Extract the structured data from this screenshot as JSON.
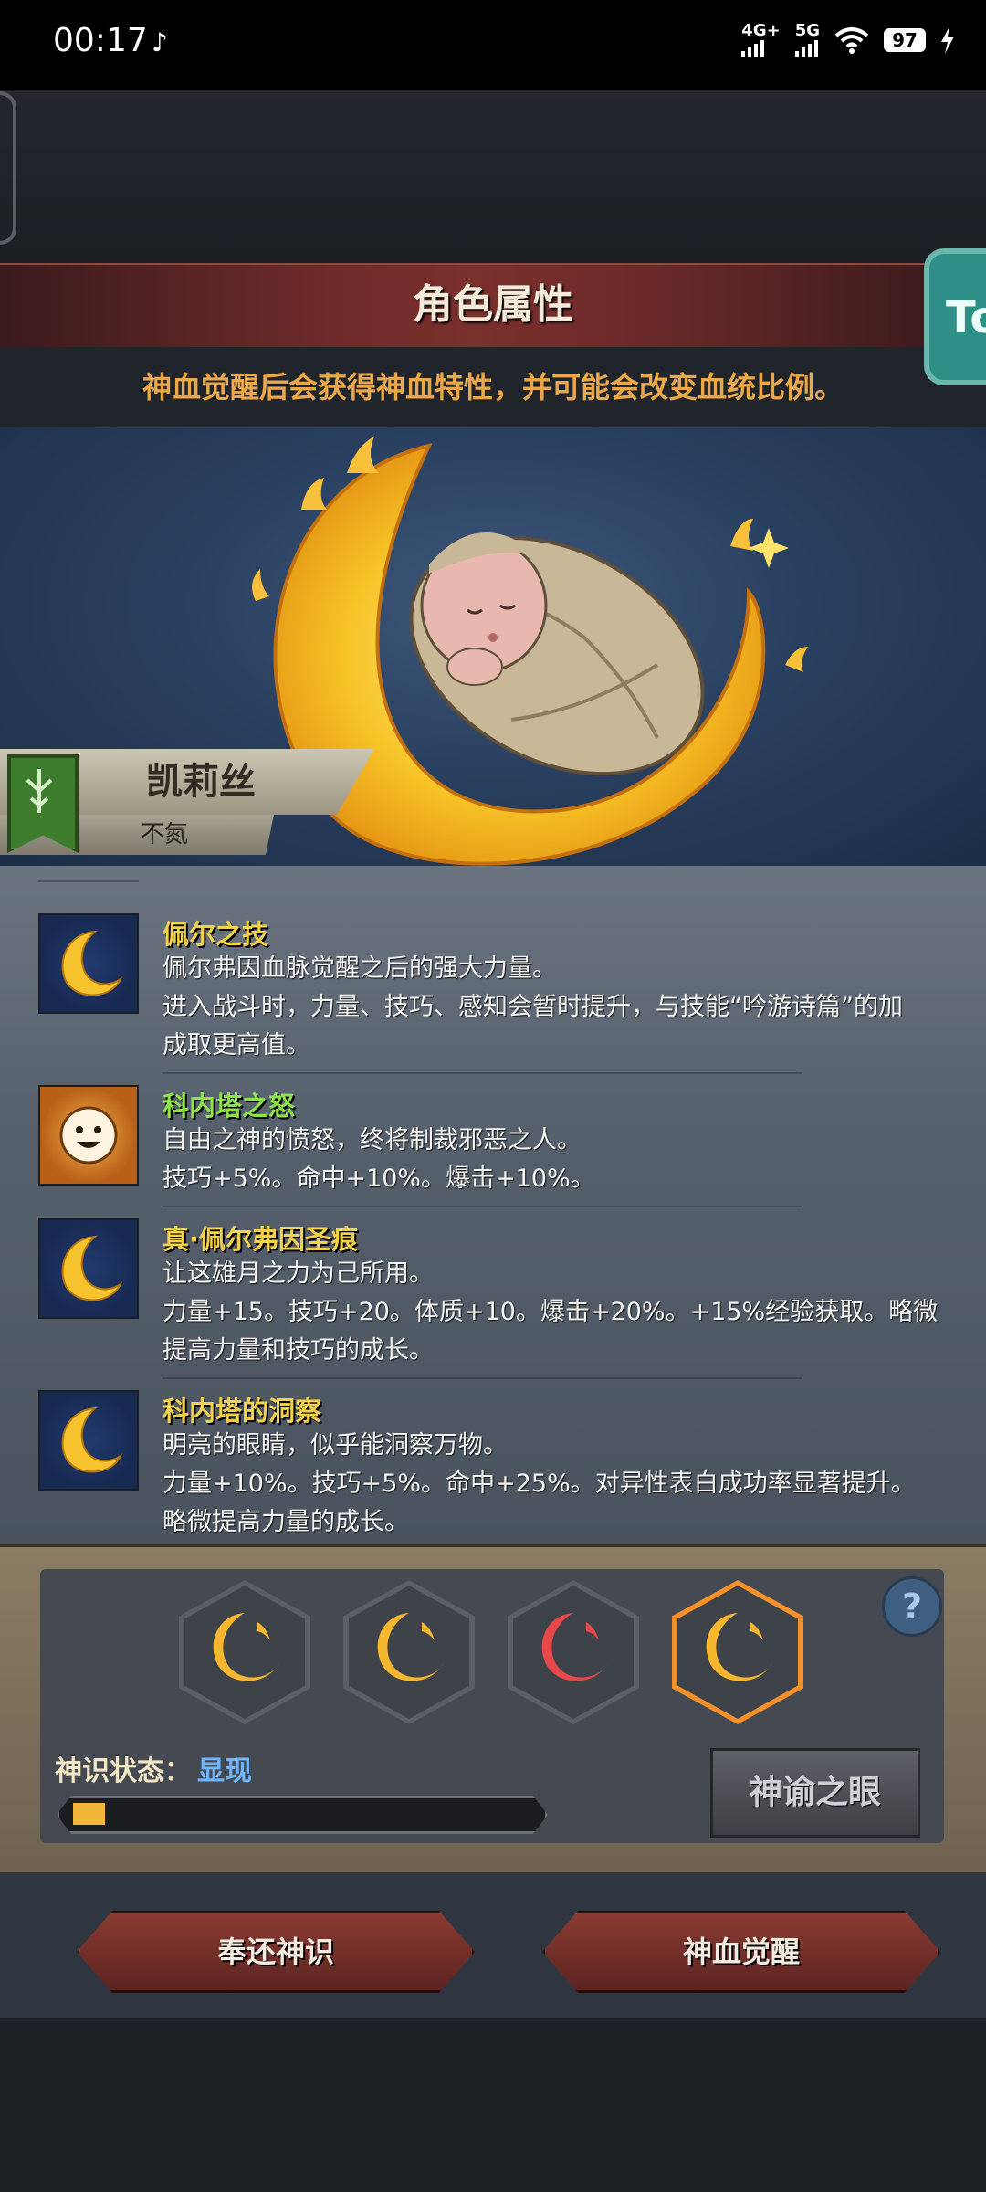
{
  "status_bar": {
    "time": "00:17",
    "network_1": "4G+",
    "network_2": "5G",
    "battery": "97"
  },
  "header": {
    "title": "角色属性",
    "subtitle": "神血觉醒后会获得神血特性，并可能会改变血统比例。",
    "side_button": "To"
  },
  "character": {
    "name": "凯莉丝",
    "sub_label": "不氮"
  },
  "traits": [
    {
      "icon": "crescent-moon-icon",
      "name": "佩尔之技",
      "name_color": "#f2d24a",
      "desc": [
        "佩尔弗因血脉觉醒之后的强大力量。",
        "进入战斗时，力量、技巧、感知会暂时提升，与技能“吟游诗篇”的加",
        "成取更高值。"
      ]
    },
    {
      "icon": "smiling-sun-icon",
      "name": "科内塔之怒",
      "name_color": "#8ee24a",
      "desc": [
        "自由之神的愤怒，终将制裁邪恶之人。",
        "技巧+5%。命中+10%。爆击+10%。"
      ]
    },
    {
      "icon": "crescent-moon-icon",
      "name": "真·佩尔弗因圣痕",
      "name_color": "#f2d24a",
      "desc": [
        "让这雄月之力为己所用。",
        "力量+15。技巧+20。体质+10。爆击+20%。+15%经验获取。略微",
        "提高力量和技巧的成长。"
      ]
    },
    {
      "icon": "crescent-moon-icon",
      "name": "科内塔的洞察",
      "name_color": "#f2d24a",
      "desc": [
        "明亮的眼睛，似乎能洞察万物。",
        "力量+10%。技巧+5%。命中+25%。对异性表白成功率显著提升。",
        "略微提高力量的成长。"
      ]
    }
  ],
  "divine_slots": [
    {
      "color": "#f6b62e",
      "active": false
    },
    {
      "color": "#f6b62e",
      "active": false
    },
    {
      "color": "#e8484a",
      "active": false
    },
    {
      "color": "#f6b62e",
      "active": true
    }
  ],
  "divine_status": {
    "label": "神识状态：",
    "value": "显现",
    "progress": 0.07
  },
  "buttons": {
    "help": "?",
    "oracle_eye": "神谕之眼",
    "return_sense": "奉还神识",
    "blood_awaken": "神血觉醒"
  }
}
